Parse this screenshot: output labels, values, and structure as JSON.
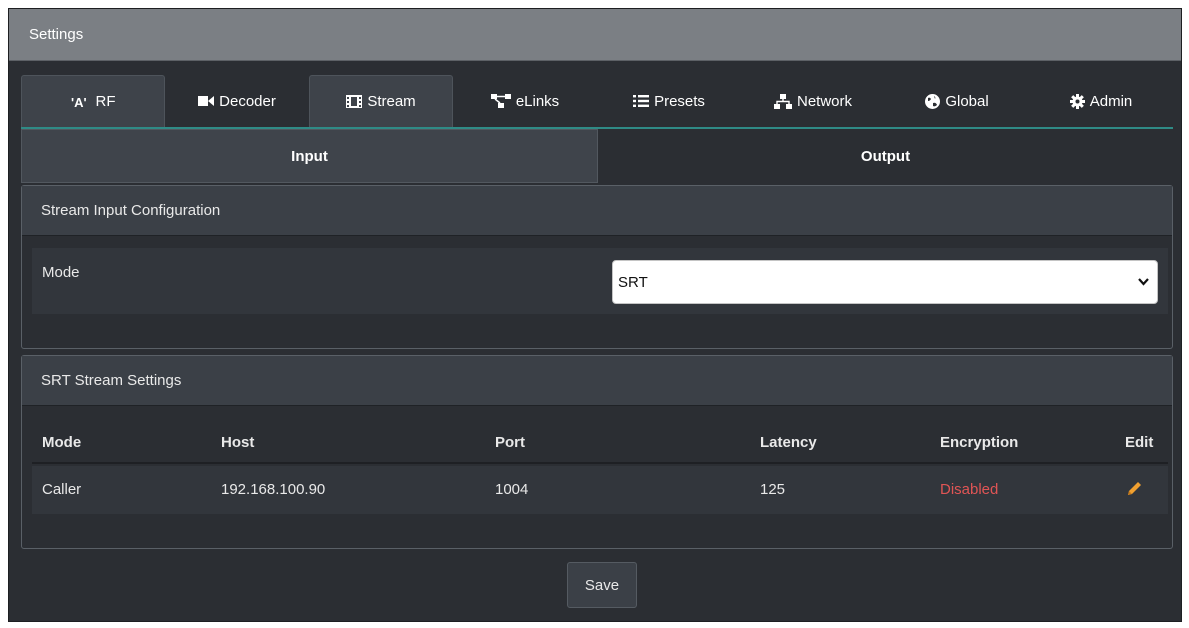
{
  "window": {
    "title": "Settings"
  },
  "tabs": [
    {
      "label": "RF",
      "icon": "antenna-icon"
    },
    {
      "label": "Decoder",
      "icon": "video-camera-icon"
    },
    {
      "label": "Stream",
      "icon": "film-icon"
    },
    {
      "label": "eLinks",
      "icon": "network-links-icon"
    },
    {
      "label": "Presets",
      "icon": "list-icon"
    },
    {
      "label": "Network",
      "icon": "sitemap-icon"
    },
    {
      "label": "Global",
      "icon": "globe-icon"
    },
    {
      "label": "Admin",
      "icon": "gear-icon"
    }
  ],
  "subtabs": [
    {
      "label": "Input"
    },
    {
      "label": "Output"
    }
  ],
  "input_config": {
    "heading": "Stream Input Configuration",
    "mode_label": "Mode",
    "mode_value": "SRT"
  },
  "srt_settings": {
    "heading": "SRT Stream Settings",
    "columns": [
      "Mode",
      "Host",
      "Port",
      "Latency",
      "Encryption",
      "Edit"
    ],
    "rows": [
      {
        "mode": "Caller",
        "host": "192.168.100.90",
        "port": "1004",
        "latency": "125",
        "encryption": "Disabled"
      }
    ]
  },
  "actions": {
    "save_label": "Save"
  },
  "colors": {
    "accent": "#2f8b86",
    "disabled": "#e05555",
    "edit_icon": "#f0a030",
    "titlebar": "#7b7f84"
  }
}
